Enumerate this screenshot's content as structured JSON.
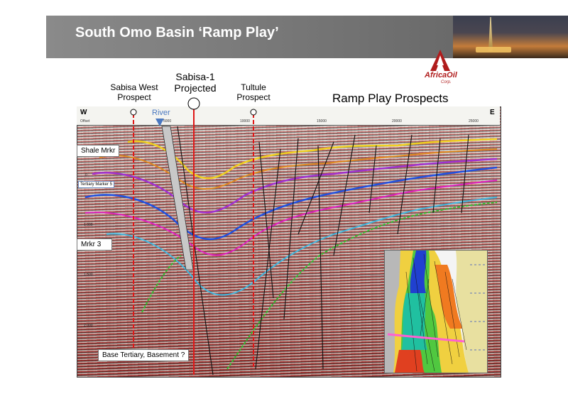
{
  "header": {
    "title": "South Omo Basin ‘Ramp Play’"
  },
  "logo": {
    "name": "AfricaOil",
    "suffix": "Corp."
  },
  "prospects": {
    "sabisa_west": "Sabisa West\nProspect",
    "sabisa_1": "Sabisa-1\nProjected",
    "tultule": "Tultule\nProspect",
    "play_title": "Ramp Play Prospects"
  },
  "section": {
    "west": "W",
    "east": "E",
    "river": "River",
    "offset_label": "Offset",
    "ticks": [
      "5000",
      "10000",
      "15000",
      "20000",
      "25000"
    ],
    "time_ticks": [
      "0",
      "1 000",
      "1 500",
      "2 000"
    ],
    "markers": {
      "shale": "Shale Mrkr",
      "tertiary5": "Tertiary Marker 5",
      "mrkr3": "Mrkr 3",
      "basement": "Base Tertiary, Basement ?"
    }
  },
  "colors": {
    "accent": "#b01c1c",
    "title_bar": "#7a7a7a",
    "well_line": "#e01818",
    "river": "#4a78c0"
  }
}
